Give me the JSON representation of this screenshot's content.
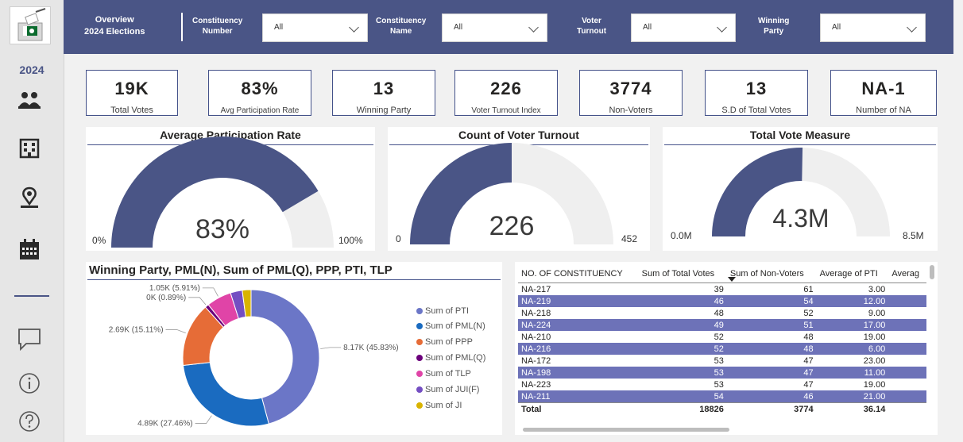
{
  "header": {
    "title_line1": "Overview",
    "title_line2": "2024 Elections",
    "filters": [
      {
        "label_line1": "Constituency",
        "label_line2": "Number",
        "value": "All"
      },
      {
        "label_line1": "Constituency",
        "label_line2": "Name",
        "value": "All"
      },
      {
        "label_line1": "Voter",
        "label_line2": "Turnout",
        "value": "All"
      },
      {
        "label_line1": "Winning",
        "label_line2": "Party",
        "value": "All"
      }
    ]
  },
  "sidebar": {
    "year": "2024",
    "icons": [
      "voters-icon",
      "building-icon",
      "location-pin-icon",
      "calendar-icon",
      "chat-icon",
      "info-icon",
      "help-icon"
    ]
  },
  "kpis": [
    {
      "value": "19K",
      "label": "Total Votes"
    },
    {
      "value": "83%",
      "label": "Avg Participation Rate"
    },
    {
      "value": "13",
      "label": "Winning Party"
    },
    {
      "value": "226",
      "label": "Voter Turnout Index"
    },
    {
      "value": "3774",
      "label": "Non-Voters"
    },
    {
      "value": "13",
      "label": "S.D of Total Votes"
    },
    {
      "value": "NA-1",
      "label": "Number of NA"
    }
  ],
  "colors": {
    "accent": "#4a5586",
    "gauge_fill": "#4a5586",
    "gauge_track": "#efefef",
    "row_highlight": "#6d72b8"
  },
  "chart_data": [
    {
      "type": "gauge",
      "title": "Average Participation Rate",
      "value": 83,
      "min": 0,
      "max": 100,
      "value_label": "83%",
      "min_label": "0%",
      "max_label": "100%"
    },
    {
      "type": "gauge",
      "title": "Count of Voter Turnout",
      "value": 226,
      "min": 0,
      "max": 452,
      "value_label": "226",
      "min_label": "0",
      "max_label": "452"
    },
    {
      "type": "gauge",
      "title": "Total Vote Measure",
      "value": 4.3,
      "min": 0,
      "max": 8.5,
      "value_label": "4.3M",
      "min_label": "0.0M",
      "max_label": "8.5M"
    },
    {
      "type": "pie",
      "title": "Winning Party, PML(N), Sum of PML(Q), PPP, PTI, TLP",
      "slices": [
        {
          "name": "Sum of PTI",
          "value": 8170,
          "label": "8.17K (45.83%)",
          "color": "#6b76c7"
        },
        {
          "name": "Sum of PML(N)",
          "value": 4890,
          "label": "4.89K (27.46%)",
          "color": "#1a6bc0"
        },
        {
          "name": "Sum of PPP",
          "value": 2690,
          "label": "2.69K (15.11%)",
          "color": "#e66c37"
        },
        {
          "name": "Sum of PML(Q)",
          "value": 160,
          "label": "0K (0.89%)",
          "color": "#6b007b"
        },
        {
          "name": "Sum of TLP",
          "value": 1050,
          "label": "1.05K (5.91%)",
          "color": "#e044a7"
        },
        {
          "name": "Sum of JUI(F)",
          "value": 500,
          "label": "",
          "color": "#744ec2"
        },
        {
          "name": "Sum of JI",
          "value": 370,
          "label": "",
          "color": "#d9b300"
        }
      ]
    }
  ],
  "table": {
    "columns": [
      "NO. OF CONSTITUENCY",
      "Sum of Total Votes",
      "Sum of Non-Voters",
      "Average of PTI",
      "Averag"
    ],
    "rows": [
      [
        "NA-217",
        "39",
        "61",
        "3.00",
        ""
      ],
      [
        "NA-219",
        "46",
        "54",
        "12.00",
        ""
      ],
      [
        "NA-218",
        "48",
        "52",
        "9.00",
        ""
      ],
      [
        "NA-224",
        "49",
        "51",
        "17.00",
        ""
      ],
      [
        "NA-210",
        "52",
        "48",
        "19.00",
        ""
      ],
      [
        "NA-216",
        "52",
        "48",
        "6.00",
        ""
      ],
      [
        "NA-172",
        "53",
        "47",
        "23.00",
        ""
      ],
      [
        "NA-198",
        "53",
        "47",
        "11.00",
        ""
      ],
      [
        "NA-223",
        "53",
        "47",
        "19.00",
        ""
      ],
      [
        "NA-211",
        "54",
        "46",
        "21.00",
        ""
      ]
    ],
    "total": [
      "Total",
      "18826",
      "3774",
      "36.14",
      ""
    ]
  }
}
